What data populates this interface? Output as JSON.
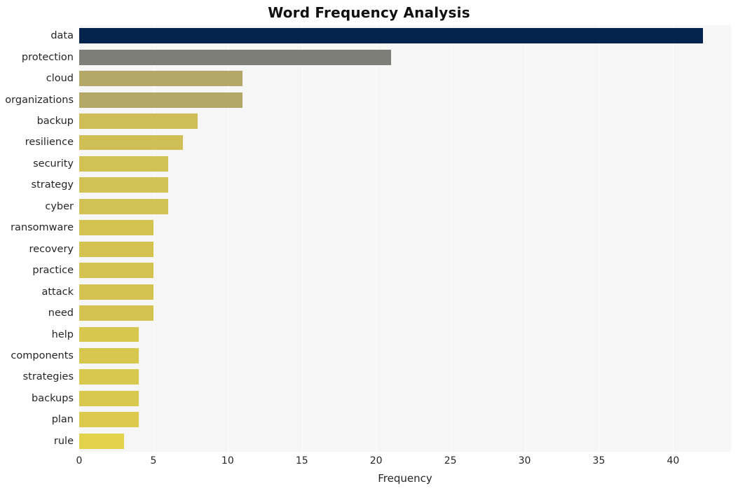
{
  "chart_data": {
    "type": "bar",
    "orientation": "horizontal",
    "title": "Word Frequency Analysis",
    "xlabel": "Frequency",
    "ylabel": "",
    "xlim": [
      0,
      43.9
    ],
    "xticks": [
      0,
      5,
      10,
      15,
      20,
      25,
      30,
      35,
      40
    ],
    "xtick_labels": [
      "0",
      "5",
      "10",
      "15",
      "20",
      "25",
      "30",
      "35",
      "40"
    ],
    "grid": "vertical",
    "legend": "none",
    "categories": [
      "data",
      "protection",
      "cloud",
      "organizations",
      "backup",
      "resilience",
      "security",
      "strategy",
      "cyber",
      "ransomware",
      "recovery",
      "practice",
      "attack",
      "need",
      "help",
      "components",
      "strategies",
      "backups",
      "plan",
      "rule"
    ],
    "values": [
      42,
      21,
      11,
      11,
      8,
      7,
      6,
      6,
      6,
      5,
      5,
      5,
      5,
      5,
      4,
      4,
      4,
      4,
      4,
      3
    ],
    "bar_colors": [
      "#04234d",
      "#7e7e78",
      "#b3a868",
      "#b3a868",
      "#cfbe58",
      "#d0bf57",
      "#d2c154",
      "#d2c154",
      "#d2c154",
      "#d4c351",
      "#d4c351",
      "#d4c351",
      "#d4c351",
      "#d4c351",
      "#d8c74f",
      "#d8c74f",
      "#d9c84e",
      "#d9c84e",
      "#dbca4d",
      "#e3d24c"
    ],
    "plot_background": "#f6f6f7",
    "gridline_color": "#ffffff",
    "figure_background": "#ffffff"
  }
}
